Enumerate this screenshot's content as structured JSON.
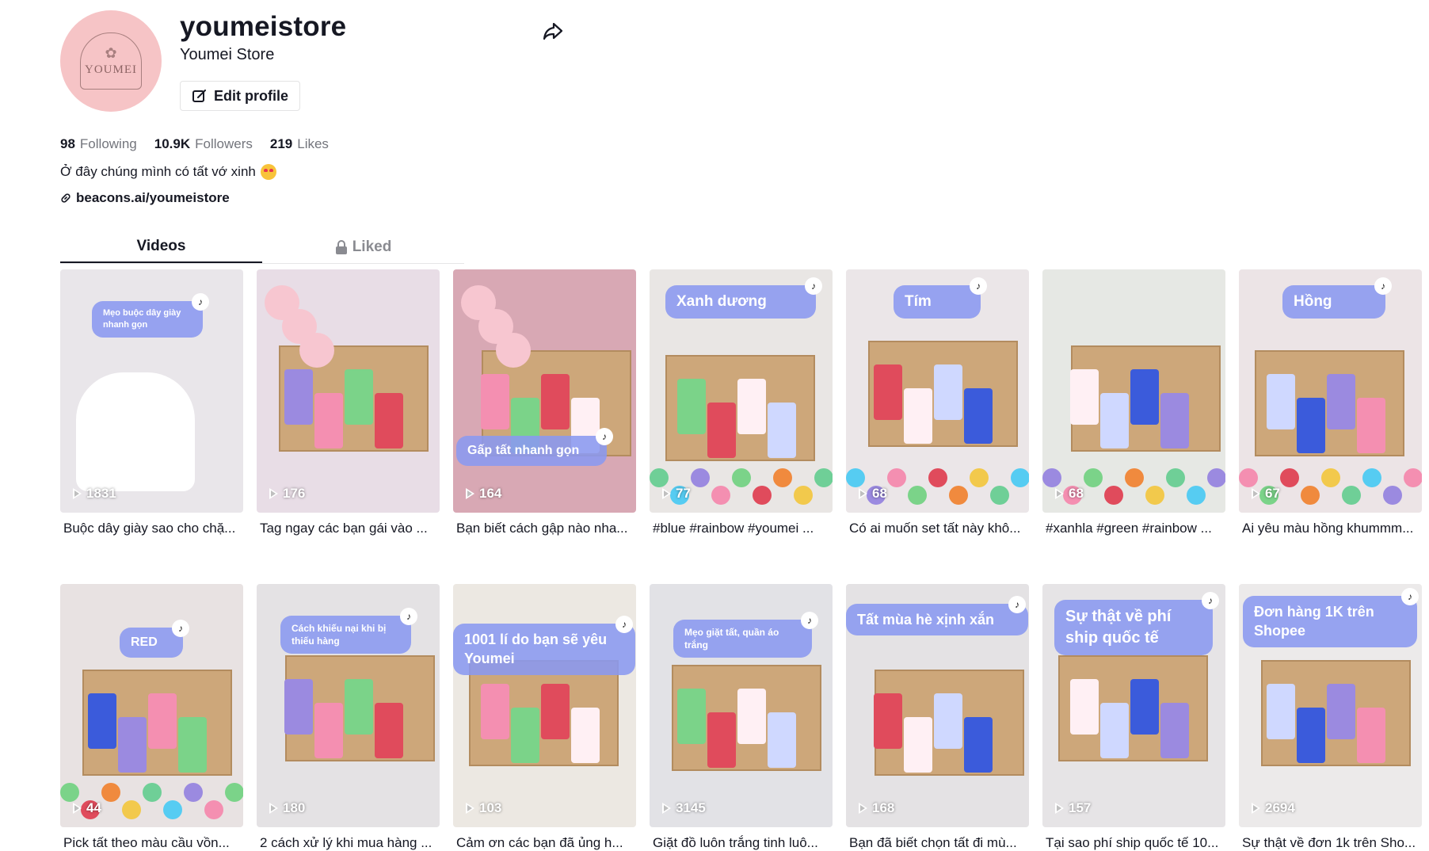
{
  "profile": {
    "username": "youmeistore",
    "nickname": "Youmei Store",
    "avatar_text": "YOUMEI",
    "edit_profile_label": "Edit profile",
    "stats": [
      {
        "value": "98",
        "label": "Following"
      },
      {
        "value": "10.9K",
        "label": "Followers"
      },
      {
        "value": "219",
        "label": "Likes"
      }
    ],
    "bio": "Ở đây chúng mình có tất vớ xinh",
    "link": "beacons.ai/youmeistore"
  },
  "tabs": {
    "videos": "Videos",
    "liked": "Liked"
  },
  "videos": [
    {
      "views": "1831",
      "caption": "Buộc dây giày sao cho chặ...",
      "overlay": "Mẹo buộc dây giày nhanh gọn",
      "bg": "#e9e6ea"
    },
    {
      "views": "176",
      "caption": "Tag ngay các bạn gái vào ...",
      "overlay": "",
      "bg": "#e8dde6"
    },
    {
      "views": "164",
      "caption": "Bạn biết cách gập nào nha...",
      "overlay": "Gấp tất nhanh gọn",
      "bg": "#d8a8b4"
    },
    {
      "views": "77",
      "caption": "#blue #rainbow #youmei ...",
      "overlay": "Xanh dương",
      "bg": "#e9e6e4"
    },
    {
      "views": "68",
      "caption": "Có ai muốn set tất này khô...",
      "overlay": "Tím",
      "bg": "#ebe6e8"
    },
    {
      "views": "68",
      "caption": "#xanhla #green #rainbow ...",
      "overlay": "",
      "bg": "#e6e8e4"
    },
    {
      "views": "67",
      "caption": "Ai yêu màu hồng khummm...",
      "overlay": "Hồng",
      "bg": "#ece4e6"
    },
    {
      "views": "44",
      "caption": "Pick tất theo màu cầu vồn...",
      "overlay": "RED",
      "bg": "#e8e2e2"
    },
    {
      "views": "180",
      "caption": "2 cách xử lý khi mua hàng ...",
      "overlay": "Cách khiếu nại khi bị thiếu hàng",
      "bg": "#e4e2e4"
    },
    {
      "views": "103",
      "caption": "Cảm ơn các bạn đã ủng h...",
      "overlay": "1001 lí do bạn sẽ yêu Youmei",
      "bg": "#ece8e2"
    },
    {
      "views": "3145",
      "caption": "Giặt đồ luôn trắng tinh luô...",
      "overlay": "Mẹo giặt tất, quần áo trắng",
      "bg": "#e2e2e6"
    },
    {
      "views": "168",
      "caption": "Bạn đã biết chọn tất đi mù...",
      "overlay": "Tất mùa hè xịnh xắn",
      "bg": "#e4e2e4"
    },
    {
      "views": "157",
      "caption": "Tại sao phí ship quốc tế 10...",
      "overlay": "Sự thật về phí ship quốc tế",
      "bg": "#e6e4e6"
    },
    {
      "views": "2694",
      "caption": "Sự thật về đơn 1k trên Sho...",
      "overlay": "Đơn hàng 1K trên Shopee",
      "bg": "#eceaea"
    }
  ]
}
